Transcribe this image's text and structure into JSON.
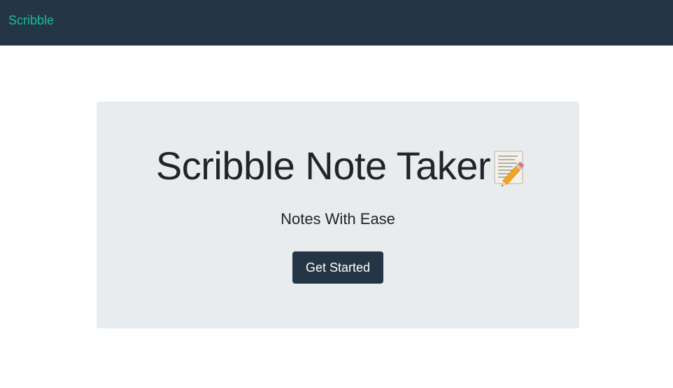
{
  "navbar": {
    "brand": "Scribble"
  },
  "hero": {
    "title": "Scribble Note Taker",
    "title_icon": "memo-icon",
    "subtitle": "Notes With Ease",
    "cta_label": "Get Started"
  },
  "colors": {
    "navbar_bg": "#243645",
    "brand": "#18bc9c",
    "hero_bg": "#e8ecee",
    "button_bg": "#243645",
    "button_text": "#ffffff",
    "text": "#212529"
  }
}
